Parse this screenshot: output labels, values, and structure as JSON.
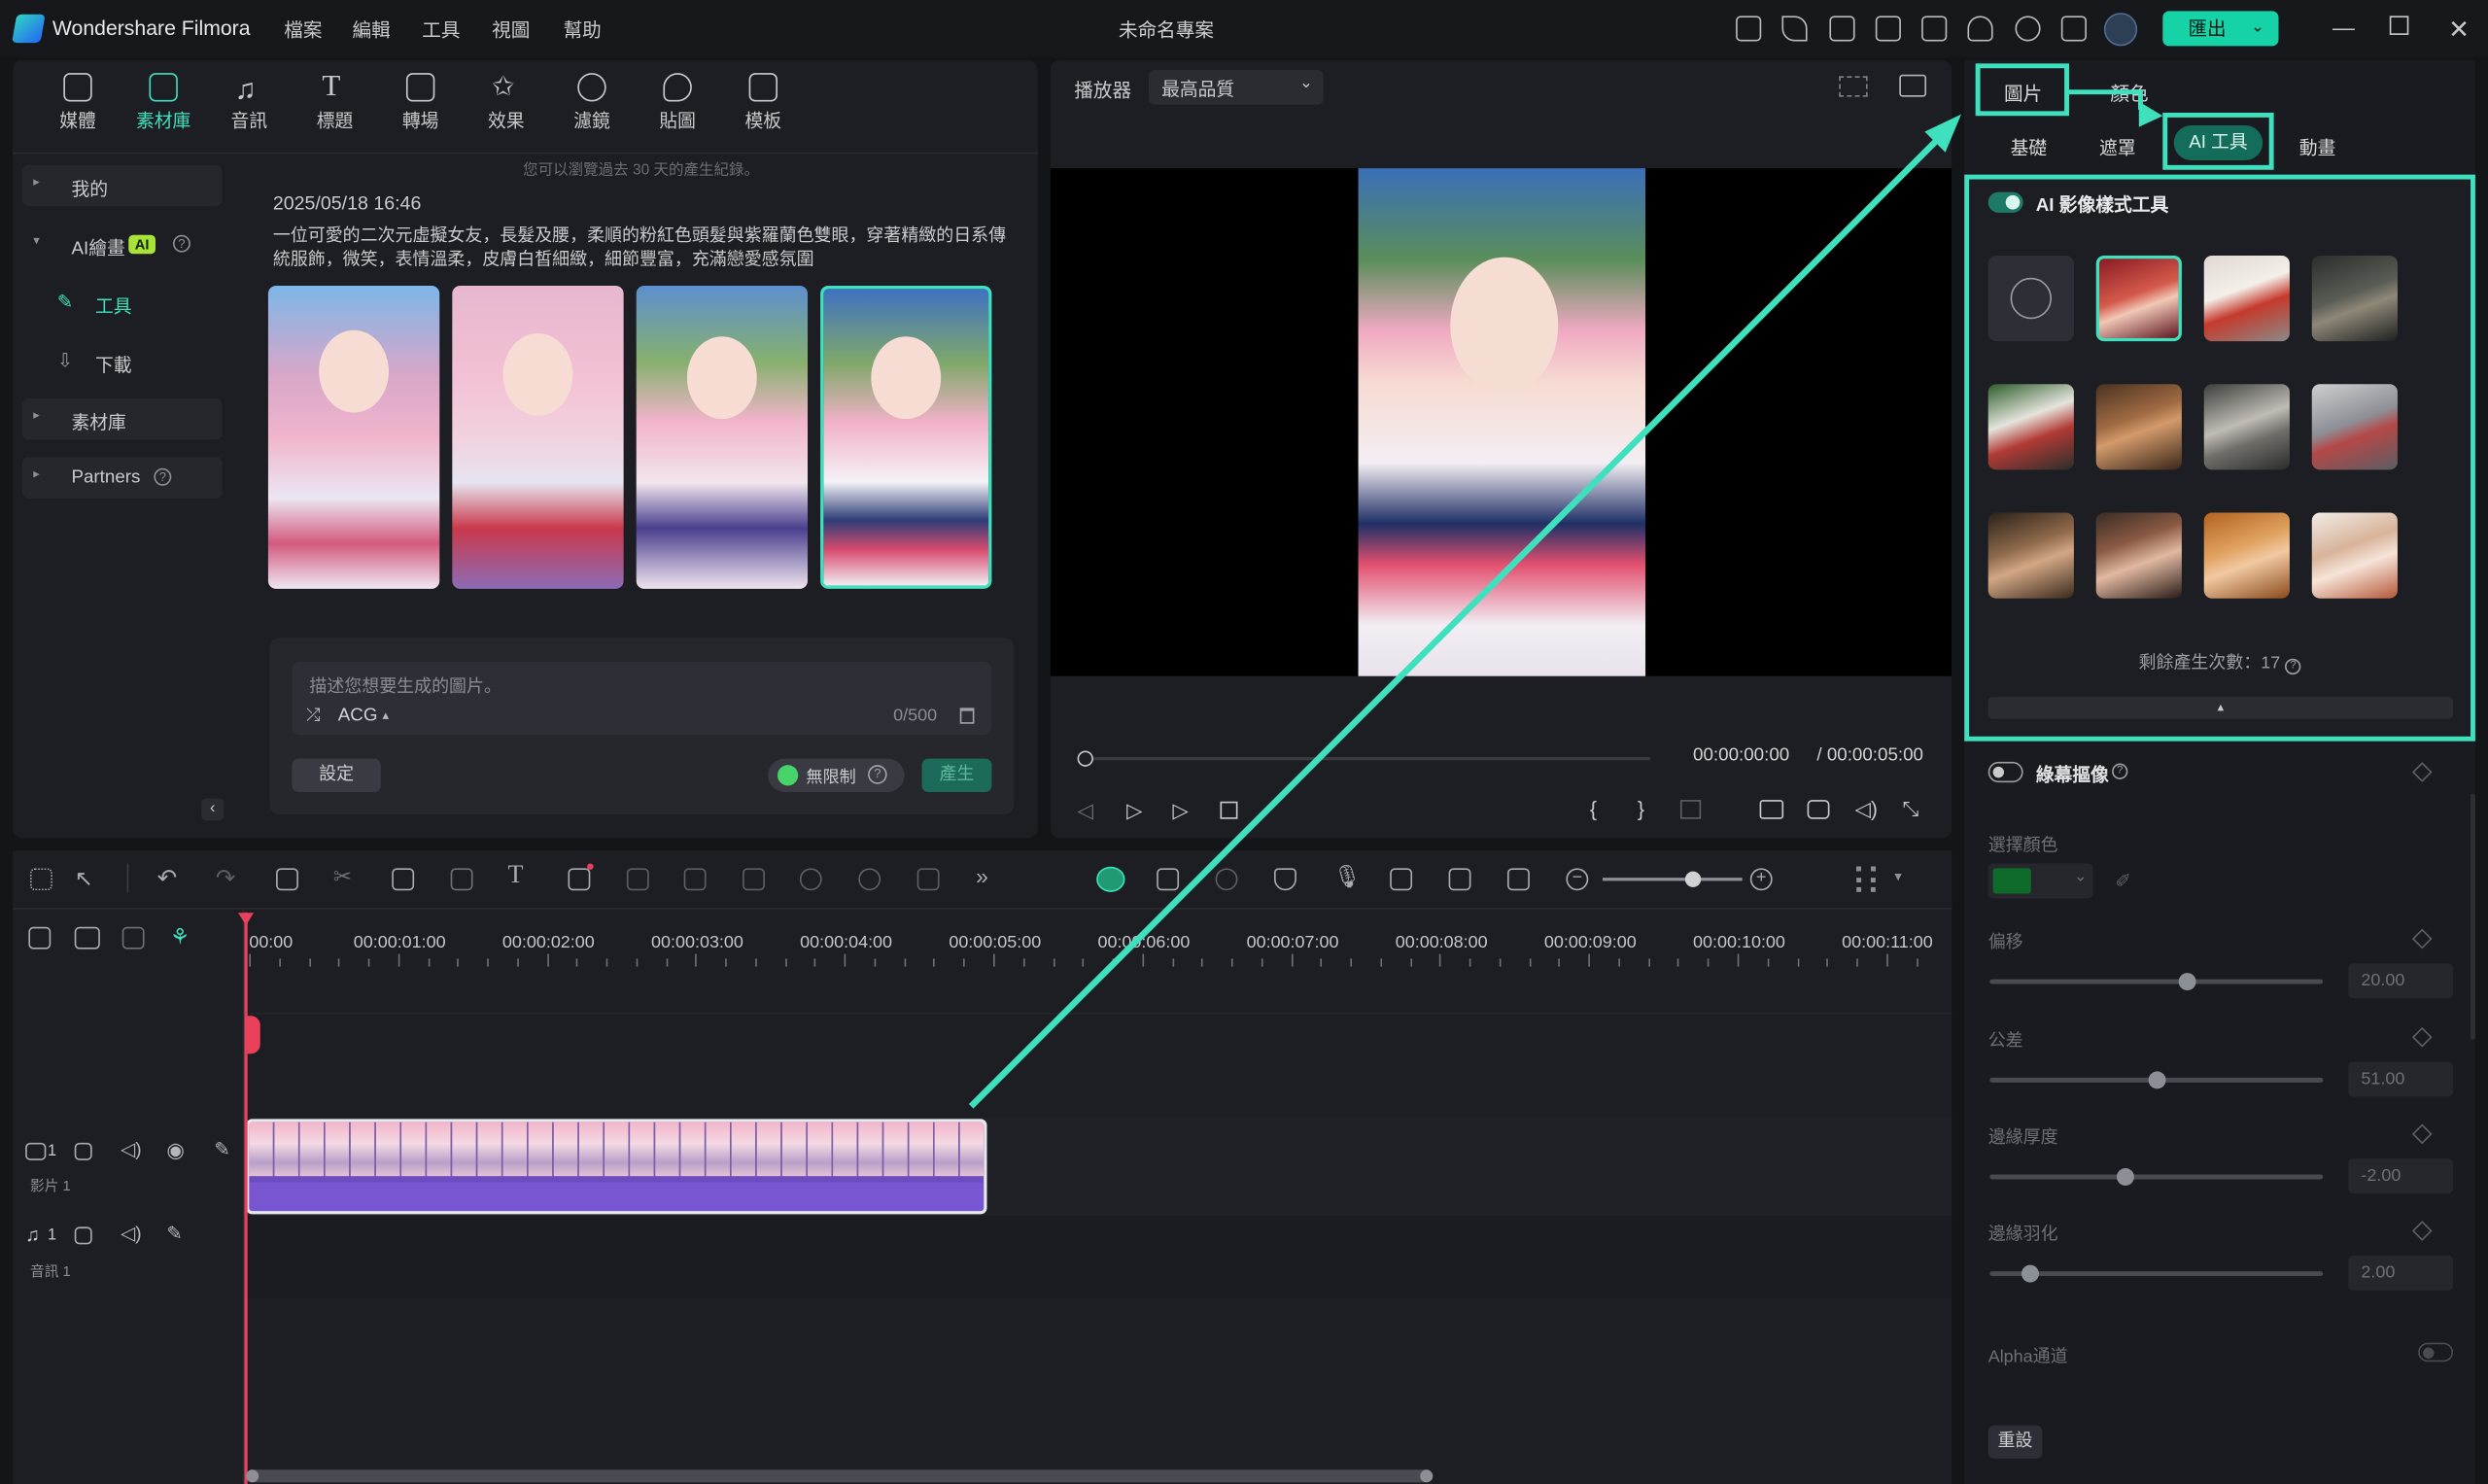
{
  "titlebar": {
    "app_name": "Wondershare Filmora",
    "menu": [
      "檔案",
      "編輯",
      "工具",
      "視圖",
      "幫助"
    ],
    "project_title": "未命名專案",
    "export_label": "匯出"
  },
  "media_tabs": [
    "媒體",
    "素材庫",
    "音訊",
    "標題",
    "轉場",
    "效果",
    "濾鏡",
    "貼圖",
    "模板"
  ],
  "sidebar": {
    "items": [
      "我的",
      "AI繪畫",
      "工具",
      "下載",
      "素材庫",
      "Partners"
    ],
    "ai_badge": "AI"
  },
  "library": {
    "history_notice": "您可以瀏覽過去 30 天的產生紀錄。",
    "timestamp": "2025/05/18 16:46",
    "prompt_text": "一位可愛的二次元虛擬女友，長髮及腰，柔順的粉紅色頭髮與紫羅蘭色雙眼，穿著精緻的日系傳統服飾，微笑，表情溫柔，皮膚白皙細緻，細節豐富，充滿戀愛感氛圍",
    "input_placeholder": "描述您想要生成的圖片。",
    "style_chip": "ACG",
    "char_count": "0/500",
    "settings_label": "設定",
    "unlimited_label": "無限制",
    "generate_label": "產生"
  },
  "player": {
    "label": "播放器",
    "quality": "最高品質",
    "current_time": "00:00:00:00",
    "total_time": "/ 00:00:05:00"
  },
  "right_panel": {
    "top_tabs": [
      "圖片",
      "顏色"
    ],
    "sub_tabs": [
      "基礎",
      "遮罩",
      "AI 工具",
      "動畫"
    ],
    "ai_style_title": "AI 影像樣式工具",
    "remaining_label": "剩餘產生次數：17",
    "chroma_title": "綠幕摳像",
    "select_color_label": "選擇顏色",
    "offset_label": "偏移",
    "offset_value": "20.00",
    "tolerance_label": "公差",
    "tolerance_value": "51.00",
    "edge_thickness_label": "邊緣厚度",
    "edge_thickness_value": "-2.00",
    "edge_feather_label": "邊緣羽化",
    "edge_feather_value": "2.00",
    "alpha_label": "Alpha通道",
    "reset_label": "重設",
    "key_color": "#0e6b2a",
    "accent": "#3fe0bd"
  },
  "timeline": {
    "ruler": [
      "00:00",
      "00:00:01:00",
      "00:00:02:00",
      "00:00:03:00",
      "00:00:04:00",
      "00:00:05:00",
      "00:00:06:00",
      "00:00:07:00",
      "00:00:08:00",
      "00:00:09:00",
      "00:00:10:00",
      "00:00:11:00"
    ],
    "video_track_label": "影片 1",
    "audio_track_label": "音訊 1",
    "video_track_num": "1",
    "audio_track_num": "1"
  }
}
